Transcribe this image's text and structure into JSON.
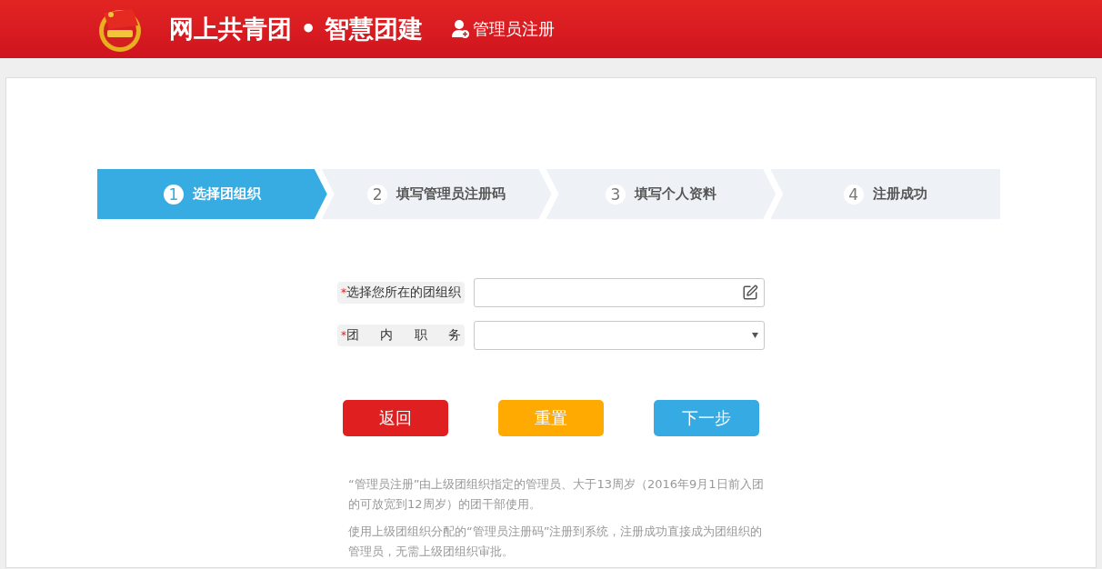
{
  "header": {
    "title": "网上共青团 • 智慧团建",
    "link": "管理员注册"
  },
  "steps": [
    {
      "number": "1",
      "label": "选择团组织",
      "selected": true
    },
    {
      "number": "2",
      "label": "填写管理员注册码",
      "selected": false
    },
    {
      "number": "3",
      "label": "填写个人资料",
      "selected": false
    },
    {
      "number": "4",
      "label": "注册成功",
      "selected": false
    }
  ],
  "fields": [
    {
      "kind": "picker",
      "mark": "*",
      "label": "选择您所在的团组织"
    },
    {
      "kind": "select",
      "mark": "*",
      "label": "团 内 职 务"
    }
  ],
  "buttons": [
    {
      "label": "返回",
      "color": "#e02020"
    },
    {
      "label": "重置",
      "color": "#ffaa00"
    },
    {
      "label": "下一步",
      "color": "#36aae2"
    }
  ],
  "notes": [
    "“管理员注册”由上级团组织指定的管理员、大于13周岁（2016年9月1日前入团的可放宽到12周岁）的团干部使用。",
    "使用上级团组织分配的“管理员注册码”注册到系统，注册成功直接成为团组织的管理员，无需上级团组织审批。"
  ]
}
